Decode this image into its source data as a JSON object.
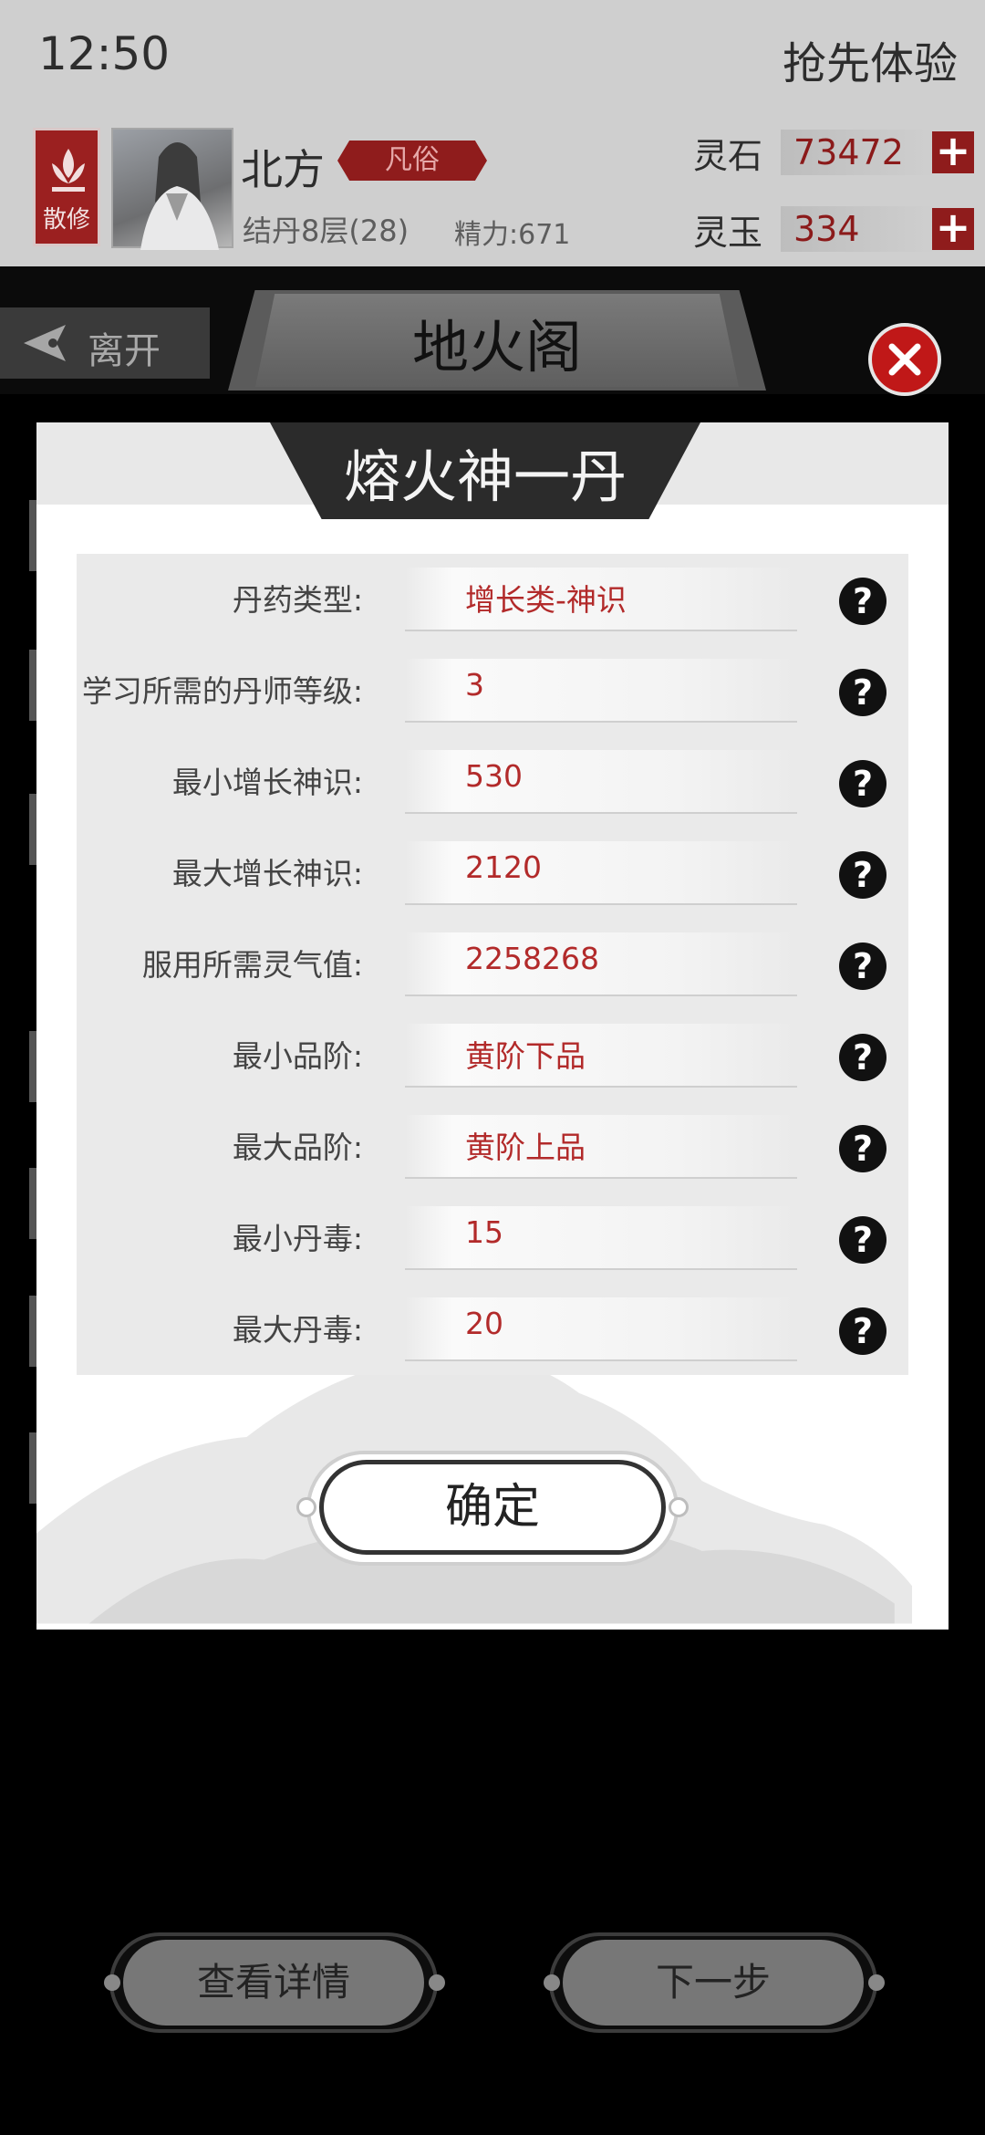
{
  "status_bar": {
    "time": "12:50",
    "promo_label": "抢先体验"
  },
  "player": {
    "sect": "散修",
    "name": "北方",
    "realm_tag": "凡俗",
    "level": "结丹8层(28)",
    "stamina": "精力:671"
  },
  "resources": [
    {
      "label": "灵石",
      "value": "73472"
    },
    {
      "label": "灵玉",
      "value": "334"
    }
  ],
  "page": {
    "back_label": "离开",
    "title": "地火阁"
  },
  "modal": {
    "title": "熔火神一丹",
    "rows": [
      {
        "label": "丹药类型:",
        "value": "增长类-神识"
      },
      {
        "label": "学习所需的丹师等级:",
        "value": "3"
      },
      {
        "label": "最小增长神识:",
        "value": "530"
      },
      {
        "label": "最大增长神识:",
        "value": "2120"
      },
      {
        "label": "服用所需灵气值:",
        "value": "2258268"
      },
      {
        "label": "最小品阶:",
        "value": "黄阶下品"
      },
      {
        "label": "最大品阶:",
        "value": "黄阶上品"
      },
      {
        "label": "最小丹毒:",
        "value": "15"
      },
      {
        "label": "最大丹毒:",
        "value": "20"
      }
    ],
    "confirm_label": "确定"
  },
  "bottom": {
    "details_label": "查看详情",
    "next_label": "下一步"
  },
  "colors": {
    "accent_red": "#8f1c1c",
    "value_red": "#b22a2a",
    "close_red": "#c01818"
  }
}
